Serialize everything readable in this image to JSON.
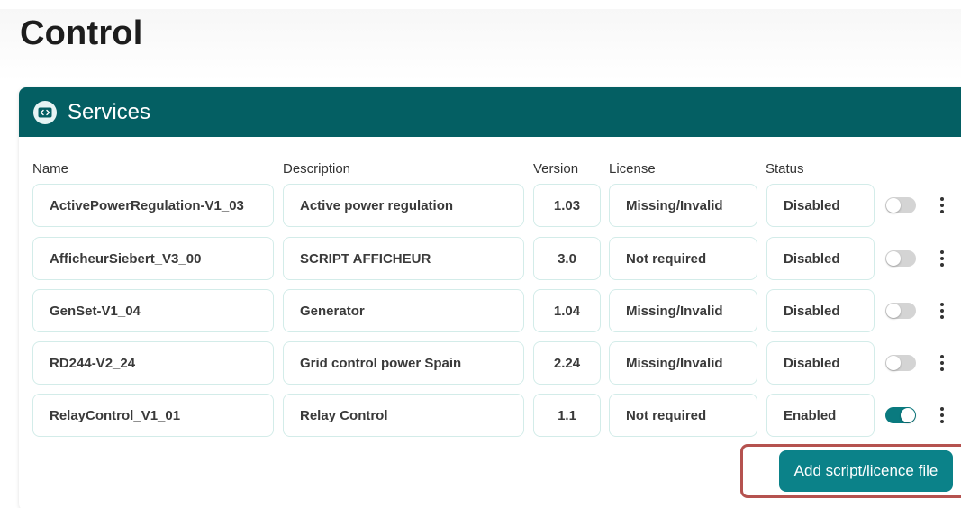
{
  "page": {
    "title": "Control"
  },
  "services": {
    "title": "Services",
    "icon": "code-icon",
    "columns": {
      "name": "Name",
      "description": "Description",
      "version": "Version",
      "license": "License",
      "status": "Status"
    },
    "rows": [
      {
        "name": "ActivePowerRegulation-V1_03",
        "description": "Active power regulation",
        "version": "1.03",
        "license": "Missing/Invalid",
        "status": "Disabled",
        "enabled": false
      },
      {
        "name": "AfficheurSiebert_V3_00",
        "description": "SCRIPT AFFICHEUR",
        "version": "3.0",
        "license": "Not required",
        "status": "Disabled",
        "enabled": false
      },
      {
        "name": "GenSet-V1_04",
        "description": "Generator",
        "version": "1.04",
        "license": "Missing/Invalid",
        "status": "Disabled",
        "enabled": false
      },
      {
        "name": "RD244-V2_24",
        "description": "Grid control power Spain",
        "version": "2.24",
        "license": "Missing/Invalid",
        "status": "Disabled",
        "enabled": false
      },
      {
        "name": "RelayControl_V1_01",
        "description": "Relay Control",
        "version": "1.1",
        "license": "Not required",
        "status": "Enabled",
        "enabled": true
      }
    ],
    "add_button_label": "Add script/licence file"
  },
  "colors": {
    "header": "#045f63",
    "accent": "#0b8289",
    "highlight": "#b5524f"
  }
}
